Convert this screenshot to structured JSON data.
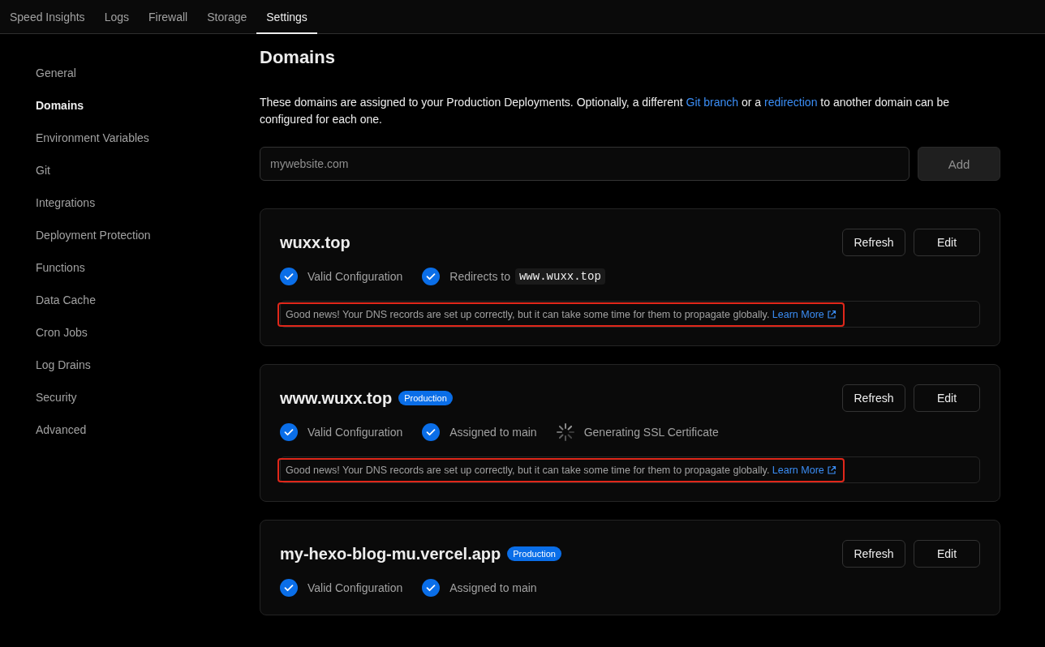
{
  "nav": {
    "tabs": [
      {
        "label": "Speed Insights",
        "selected": false
      },
      {
        "label": "Logs",
        "selected": false
      },
      {
        "label": "Firewall",
        "selected": false
      },
      {
        "label": "Storage",
        "selected": false
      },
      {
        "label": "Settings",
        "selected": true
      }
    ]
  },
  "sidebar": {
    "items": [
      {
        "label": "General",
        "selected": false
      },
      {
        "label": "Domains",
        "selected": true
      },
      {
        "label": "Environment Variables",
        "selected": false
      },
      {
        "label": "Git",
        "selected": false
      },
      {
        "label": "Integrations",
        "selected": false
      },
      {
        "label": "Deployment Protection",
        "selected": false
      },
      {
        "label": "Functions",
        "selected": false
      },
      {
        "label": "Data Cache",
        "selected": false
      },
      {
        "label": "Cron Jobs",
        "selected": false
      },
      {
        "label": "Log Drains",
        "selected": false
      },
      {
        "label": "Security",
        "selected": false
      },
      {
        "label": "Advanced",
        "selected": false
      }
    ]
  },
  "page": {
    "title": "Domains",
    "description": [
      {
        "kind": "text",
        "text": "These domains are assigned to your Production Deployments. Optionally, a different "
      },
      {
        "kind": "link",
        "text": "Git branch"
      },
      {
        "kind": "text",
        "text": " or a "
      },
      {
        "kind": "link",
        "text": "redirection"
      },
      {
        "kind": "text",
        "text": " to another domain can be configured for each one."
      }
    ]
  },
  "add_domain": {
    "placeholder": "mywebsite.com",
    "button": {
      "label": "Add",
      "disabled": true
    }
  },
  "domains": [
    {
      "name": "wuxx.top",
      "buttons": [
        "Refresh",
        "Edit"
      ],
      "statuses": [
        {
          "kind": "check",
          "label": "Valid Configuration"
        },
        {
          "kind": "check",
          "label": "Redirects to",
          "code": "www.wuxx.top"
        }
      ],
      "notice": {
        "text": "Good news! Your DNS records are set up correctly, but it can take some time for them to propagate globally.",
        "link": "Learn More",
        "highlighted": true
      }
    },
    {
      "name": "www.wuxx.top",
      "badge": "Production",
      "buttons": [
        "Refresh",
        "Edit"
      ],
      "statuses": [
        {
          "kind": "check",
          "label": "Valid Configuration"
        },
        {
          "kind": "check",
          "label": "Assigned to main"
        },
        {
          "kind": "spinner",
          "label": "Generating SSL Certificate"
        }
      ],
      "notice": {
        "text": "Good news! Your DNS records are set up correctly, but it can take some time for them to propagate globally.",
        "link": "Learn More",
        "highlighted": true
      }
    },
    {
      "name": "my-hexo-blog-mu.vercel.app",
      "badge": "Production",
      "buttons": [
        "Refresh",
        "Edit"
      ],
      "statuses": [
        {
          "kind": "check",
          "label": "Valid Configuration"
        },
        {
          "kind": "check",
          "label": "Assigned to main"
        }
      ]
    }
  ]
}
